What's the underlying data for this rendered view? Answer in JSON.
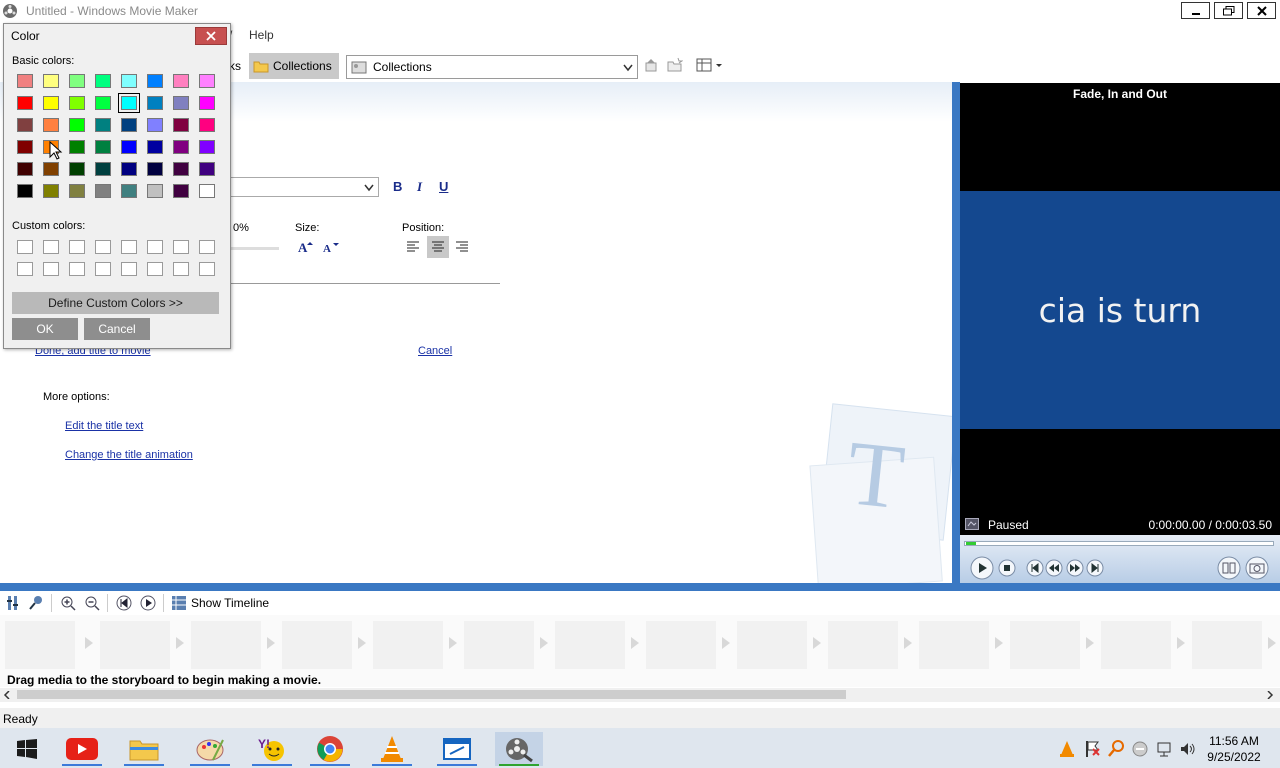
{
  "window": {
    "title": "Untitled - Windows Movie Maker"
  },
  "menu": {
    "help": "Help"
  },
  "toolbar": {
    "tasks_partial": "ks",
    "collections_button": "Collections",
    "collections_select": "Collections"
  },
  "title_editor": {
    "size_label": "Size:",
    "position_label": "Position:",
    "transparency_partial": "0%",
    "done_link": "Done, add title to movie",
    "cancel_link": "Cancel",
    "more_options": "More options:",
    "edit_text_link": "Edit the title text",
    "change_animation_link": "Change the title animation",
    "bold": "B",
    "italic": "I",
    "underline": "U"
  },
  "preview": {
    "title": "Fade, In and Out",
    "screen_text": "cia is turn",
    "status": "Paused",
    "time": "0:00:00.00 / 0:00:03.50"
  },
  "storyboard": {
    "show_timeline": "Show Timeline",
    "hint": "Drag media to the storyboard to begin making a movie."
  },
  "statusbar": {
    "text": "Ready"
  },
  "color_dialog": {
    "title": "Color",
    "basic_colors_label": "Basic colors:",
    "custom_colors_label": "Custom colors:",
    "define_button": "Define Custom Colors >>",
    "ok_button": "OK",
    "cancel_button": "Cancel",
    "selected_index": 12,
    "basic_colors": [
      "#f08080",
      "#ffff80",
      "#80ff80",
      "#00ff80",
      "#80ffff",
      "#0080ff",
      "#ff80c0",
      "#ff80ff",
      "#ff0000",
      "#ffff00",
      "#80ff00",
      "#00ff40",
      "#00ffff",
      "#0080c0",
      "#8080c0",
      "#ff00ff",
      "#804040",
      "#ff8040",
      "#00ff00",
      "#008080",
      "#004080",
      "#8080ff",
      "#800040",
      "#ff0080",
      "#800000",
      "#ff8000",
      "#008000",
      "#008040",
      "#0000ff",
      "#0000a0",
      "#800080",
      "#8000ff",
      "#400000",
      "#804000",
      "#004000",
      "#004040",
      "#000080",
      "#000040",
      "#400040",
      "#400080",
      "#000000",
      "#808000",
      "#808040",
      "#808080",
      "#408080",
      "#c0c0c0",
      "#400040",
      "#ffffff"
    ]
  },
  "taskbar": {
    "time": "11:56 AM",
    "date": "9/25/2022"
  },
  "colors": {
    "accent_blue": "#3a78c3",
    "preview_bg": "#14488f",
    "close_red": "#c75050"
  }
}
